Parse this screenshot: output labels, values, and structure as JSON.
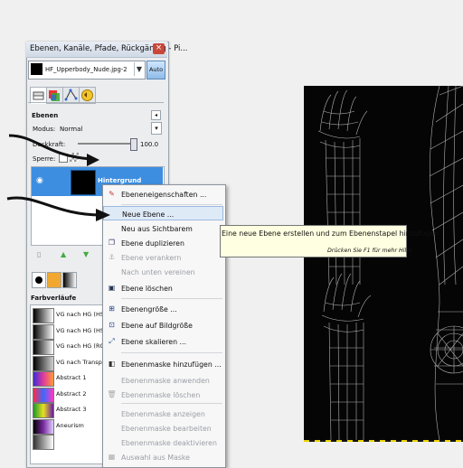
{
  "dock": {
    "title": "Ebenen, Kanäle, Pfade, Rückgängig - Pi...",
    "image_name": "HF_Upperbody_Nude.jpg-2",
    "auto_label": "Auto",
    "section_label": "Ebenen",
    "mode_label": "Modus:",
    "mode_value": "Normal",
    "opacity_label": "Deckkraft:",
    "opacity_value": "100.0",
    "lock_label": "Sperre:",
    "layer_name": "Hintergrund",
    "gradients_label": "Farbverläufe",
    "gradients": [
      {
        "name": "VG nach HG (HSV",
        "colors": [
          "#000000",
          "#ffffff"
        ]
      },
      {
        "name": "VG nach HG (HSV",
        "colors": [
          "#000000",
          "#ffffff"
        ]
      },
      {
        "name": "VG nach HG (RGB",
        "colors": [
          "#000000",
          "#ffffff"
        ]
      },
      {
        "name": "VG nach Transpar",
        "colors": [
          "#000000",
          "#cfcfcf"
        ]
      },
      {
        "name": "Abstract 1",
        "colors": [
          "#3b2bd6",
          "#e23a9a",
          "#ff9a3a"
        ]
      },
      {
        "name": "Abstract 2",
        "colors": [
          "#ff2a4a",
          "#3a6aff",
          "#ff3ac0"
        ]
      },
      {
        "name": "Abstract 3",
        "colors": [
          "#1a9a2a",
          "#e8e020",
          "#6a1aa0"
        ]
      },
      {
        "name": "Aneurism",
        "colors": [
          "#000000",
          "#7a2aa0",
          "#e0d0ff"
        ]
      },
      {
        "name": "",
        "colors": [
          "#333333",
          "#ffffff"
        ]
      }
    ]
  },
  "menu": {
    "items": [
      {
        "label": "Ebeneneigenschaften ...",
        "icon": "edit-icon",
        "enabled": true
      },
      {
        "label": "Neue Ebene ...",
        "icon": "new-layer-icon",
        "enabled": true,
        "highlighted": true
      },
      {
        "label": "Neu aus Sichtbarem",
        "icon": "",
        "enabled": true
      },
      {
        "label": "Ebene duplizieren",
        "icon": "duplicate-icon",
        "enabled": true
      },
      {
        "label": "Ebene verankern",
        "icon": "anchor-icon",
        "enabled": false
      },
      {
        "label": "Nach unten vereinen",
        "icon": "",
        "enabled": false
      },
      {
        "label": "Ebene löschen",
        "icon": "delete-icon",
        "enabled": true
      },
      {
        "label": "Ebenengröße ...",
        "icon": "resize-icon",
        "enabled": true
      },
      {
        "label": "Ebene auf Bildgröße",
        "icon": "fit-icon",
        "enabled": true
      },
      {
        "label": "Ebene skalieren ...",
        "icon": "scale-icon",
        "enabled": true
      },
      {
        "label": "Ebenenmaske hinzufügen ...",
        "icon": "mask-add-icon",
        "enabled": true
      },
      {
        "label": "Ebenenmaske anwenden",
        "icon": "",
        "enabled": false
      },
      {
        "label": "Ebenenmaske löschen",
        "icon": "trash-icon",
        "enabled": false
      },
      {
        "label": "Ebenenmaske anzeigen",
        "icon": "",
        "enabled": false
      },
      {
        "label": "Ebenenmaske bearbeiten",
        "icon": "",
        "enabled": false
      },
      {
        "label": "Ebenenmaske deaktivieren",
        "icon": "",
        "enabled": false
      },
      {
        "label": "Auswahl aus Maske",
        "icon": "selection-icon",
        "enabled": false
      }
    ]
  },
  "tooltip": {
    "text": "Eine neue Ebene erstellen und zum Ebenenstapel hinzufügen",
    "hint": "Drücken Sie F1 für mehr Hilfe"
  }
}
